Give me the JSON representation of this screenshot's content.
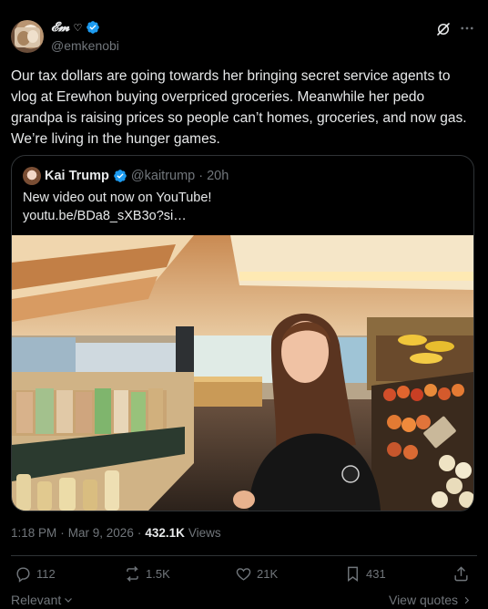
{
  "author": {
    "display_name": "𝓔𝓶",
    "heart": "♡",
    "handle": "@emkenobi"
  },
  "post": {
    "text": "Our tax dollars are going towards her bringing secret service agents to vlog at Erewhon buying overpriced groceries. Meanwhile her pedo grandpa is raising prices so people can’t homes, groceries, and now gas. We’re living in the hunger games."
  },
  "quote": {
    "display_name": "Kai Trump",
    "handle": "@kaitrump",
    "separator": "·",
    "time": "20h",
    "text_line1": "New video out now on YouTube!",
    "text_line2": "youtu.be/BDa8_sXB3o?si…"
  },
  "meta": {
    "time": "1:18 PM",
    "sep1": "·",
    "date": "Mar 9, 2026",
    "sep2": "·",
    "views_count": "432.1K",
    "views_label": "Views"
  },
  "actions": {
    "replies": "112",
    "reposts": "1.5K",
    "likes": "21K",
    "bookmarks": "431"
  },
  "footer": {
    "relevant_label": "Relevant",
    "view_quotes_label": "View quotes"
  },
  "colors": {
    "background": "#000000",
    "text": "#e7e9ea",
    "secondary": "#71767b",
    "verified": "#1d9bf0",
    "border": "#2f3336"
  },
  "icons": {
    "verified": "verified-badge-icon",
    "grok": "grok-icon",
    "more": "more-icon",
    "reply": "reply-icon",
    "repost": "repost-icon",
    "like": "heart-icon",
    "bookmark": "bookmark-icon",
    "share": "share-icon"
  }
}
